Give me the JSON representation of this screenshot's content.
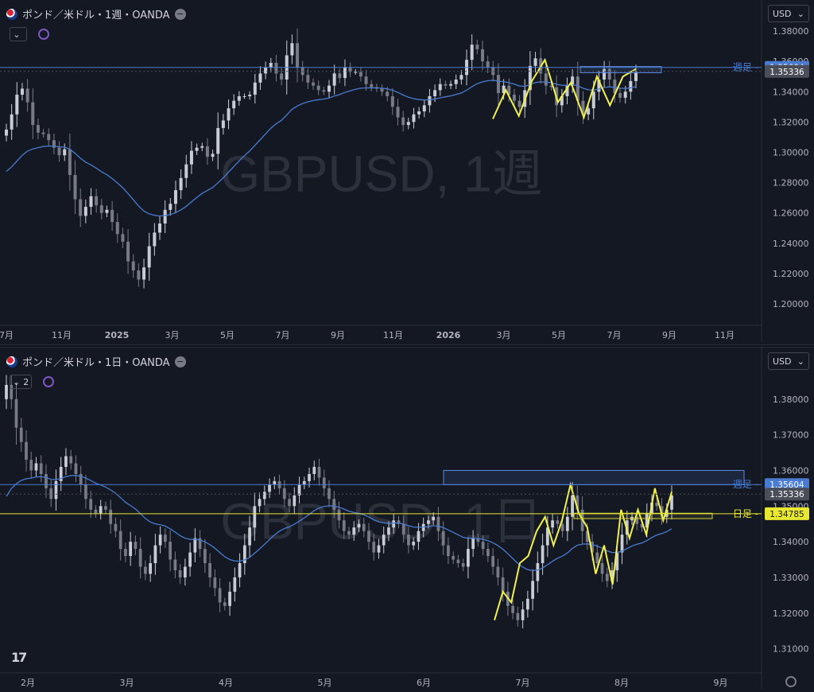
{
  "top": {
    "symbol_title": "ポンド／米ドル・1週・OANDA",
    "watermark": "GBPUSD, 1週",
    "currency": "USD",
    "collapse_label": "",
    "colors": {
      "up": "#c8ccd4",
      "down": "#787b86",
      "ma": "#4a7bd0",
      "zigzag": "#f2f24a",
      "week_line": "#4a7bd0",
      "week_box": "#5a8ae0"
    }
  },
  "bottom": {
    "symbol_title": "ポンド／米ドル・1日・OANDA",
    "watermark": "GBPUSD, 1日",
    "currency": "USD",
    "collapse_label": "2",
    "colors": {
      "up": "#c8ccd4",
      "down": "#787b86",
      "ma": "#4a7bd0",
      "zigzag": "#f2f24a",
      "week_line": "#4a7bd0",
      "day_line": "#d6d63a"
    }
  },
  "chart_data": [
    {
      "type": "candlestick",
      "title": "ポンド／米ドル・1週・OANDA",
      "ylim": [
        1.19,
        1.39
      ],
      "y_ticks": [
        "1.38000",
        "1.36000",
        "1.34000",
        "1.32000",
        "1.30000",
        "1.28000",
        "1.26000",
        "1.24000",
        "1.22000",
        "1.20000"
      ],
      "x_ticks": [
        "7月",
        "11月",
        "2025",
        "3月",
        "5月",
        "7月",
        "9月",
        "11月",
        "2026",
        "3月",
        "5月",
        "7月",
        "9月",
        "11月"
      ],
      "price_labels": [
        {
          "label": "週足",
          "value": 1.35604,
          "text": "1.35604",
          "color": "#4a7bd0"
        },
        {
          "label": "",
          "value": 1.35336,
          "text": "1.35336",
          "color": "#4a4e59"
        }
      ],
      "ohlc_close": [
        1.315,
        1.325,
        1.338,
        1.342,
        1.333,
        1.318,
        1.313,
        1.312,
        1.308,
        1.303,
        1.298,
        1.302,
        1.285,
        1.269,
        1.258,
        1.264,
        1.271,
        1.265,
        1.26,
        1.262,
        1.254,
        1.246,
        1.241,
        1.228,
        1.222,
        1.216,
        1.224,
        1.238,
        1.247,
        1.253,
        1.262,
        1.266,
        1.275,
        1.283,
        1.292,
        1.301,
        1.303,
        1.304,
        1.297,
        1.299,
        1.316,
        1.321,
        1.329,
        1.334,
        1.337,
        1.337,
        1.338,
        1.346,
        1.352,
        1.356,
        1.359,
        1.352,
        1.348,
        1.364,
        1.372,
        1.356,
        1.351,
        1.346,
        1.344,
        1.341,
        1.34,
        1.344,
        1.352,
        1.349,
        1.356,
        1.353,
        1.353,
        1.35,
        1.345,
        1.343,
        1.342,
        1.34,
        1.337,
        1.33,
        1.323,
        1.318,
        1.32,
        1.325,
        1.327,
        1.331,
        1.337,
        1.341,
        1.345,
        1.344,
        1.345,
        1.348,
        1.351,
        1.361,
        1.371,
        1.368,
        1.36,
        1.356,
        1.351,
        1.339,
        1.344,
        1.338,
        1.334,
        1.33,
        1.341,
        1.357,
        1.362,
        1.352,
        1.344,
        1.343,
        1.331,
        1.337,
        1.344,
        1.35,
        1.334,
        1.325,
        1.329,
        1.34,
        1.348,
        1.355,
        1.348,
        1.339,
        1.336,
        1.34,
        1.347,
        1.353
      ],
      "ma_start": 1.285,
      "zigzag": [
        1.322,
        1.341,
        1.324,
        1.347,
        1.361,
        1.333,
        1.346,
        1.323,
        1.35,
        1.331,
        1.35,
        1.355
      ],
      "week_box": [
        1.3525,
        1.3566
      ]
    },
    {
      "type": "candlestick",
      "title": "ポンド／米ドル・1日・OANDA",
      "ylim": [
        1.305,
        1.39
      ],
      "y_ticks": [
        "1.38000",
        "1.37000",
        "1.36000",
        "1.35000",
        "1.34000",
        "1.33000",
        "1.32000",
        "1.31000"
      ],
      "x_ticks": [
        "2月",
        "3月",
        "4月",
        "5月",
        "6月",
        "7月",
        "8月",
        "9月"
      ],
      "price_labels": [
        {
          "label": "週足",
          "value": 1.35604,
          "text": "1.35604",
          "color": "#4a7bd0"
        },
        {
          "label": "",
          "value": 1.35336,
          "text": "1.35336",
          "color": "#4a4e59"
        },
        {
          "label": "日足",
          "value": 1.34785,
          "text": "1.34785",
          "color": "#e8e832"
        }
      ],
      "ohlc_close": [
        1.384,
        1.38,
        1.372,
        1.368,
        1.363,
        1.36,
        1.362,
        1.359,
        1.355,
        1.352,
        1.357,
        1.361,
        1.364,
        1.362,
        1.359,
        1.356,
        1.352,
        1.349,
        1.348,
        1.35,
        1.349,
        1.345,
        1.343,
        1.338,
        1.336,
        1.34,
        1.338,
        1.333,
        1.331,
        1.334,
        1.339,
        1.342,
        1.34,
        1.335,
        1.332,
        1.33,
        1.333,
        1.337,
        1.341,
        1.338,
        1.334,
        1.33,
        1.327,
        1.323,
        1.322,
        1.326,
        1.33,
        1.334,
        1.339,
        1.344,
        1.35,
        1.352,
        1.354,
        1.356,
        1.357,
        1.355,
        1.352,
        1.35,
        1.353,
        1.356,
        1.357,
        1.359,
        1.361,
        1.358,
        1.355,
        1.352,
        1.349,
        1.346,
        1.343,
        1.342,
        1.344,
        1.345,
        1.343,
        1.34,
        1.337,
        1.339,
        1.342,
        1.344,
        1.346,
        1.345,
        1.342,
        1.339,
        1.34,
        1.343,
        1.345,
        1.346,
        1.347,
        1.343,
        1.339,
        1.336,
        1.335,
        1.334,
        1.333,
        1.338,
        1.341,
        1.34,
        1.338,
        1.336,
        1.333,
        1.33,
        1.326,
        1.322,
        1.32,
        1.318,
        1.321,
        1.324,
        1.329,
        1.334,
        1.339,
        1.344,
        1.346,
        1.345,
        1.343,
        1.347,
        1.353,
        1.349,
        1.343,
        1.34,
        1.337,
        1.334,
        1.331,
        1.329,
        1.332,
        1.337,
        1.342,
        1.346,
        1.347,
        1.345,
        1.344,
        1.348,
        1.351,
        1.35,
        1.347,
        1.349,
        1.353
      ],
      "ma_start": 1.35,
      "zigzag": [
        1.318,
        1.326,
        1.323,
        1.334,
        1.336,
        1.343,
        1.347,
        1.339,
        1.346,
        1.356,
        1.348,
        1.344,
        1.331,
        1.339,
        1.328,
        1.349,
        1.341,
        1.349,
        1.342,
        1.355,
        1.346,
        1.354
      ],
      "week_box": [
        1.356,
        1.36
      ],
      "day_box": [
        1.3465,
        1.348
      ]
    }
  ]
}
